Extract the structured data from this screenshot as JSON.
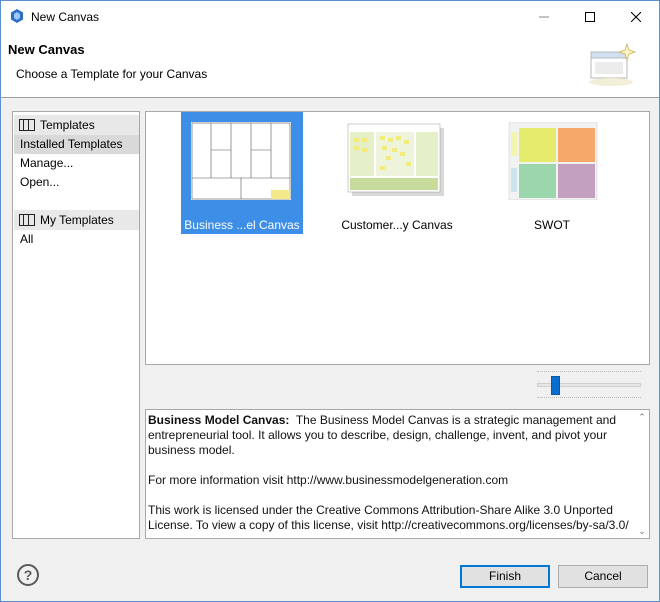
{
  "window": {
    "title": "New Canvas"
  },
  "header": {
    "title": "New Canvas",
    "subtitle": "Choose a Template for your Canvas"
  },
  "sidebar": {
    "groups": [
      {
        "label": "Templates",
        "icon": "table-icon",
        "items": [
          "Installed Templates",
          "Manage...",
          "Open..."
        ],
        "selected": "Installed Templates"
      },
      {
        "label": "My Templates",
        "icon": "table-icon",
        "items": [
          "All"
        ]
      }
    ]
  },
  "templates": [
    {
      "label": "Business ...el Canvas",
      "selected": true
    },
    {
      "label": "Customer...y Canvas",
      "selected": false
    },
    {
      "label": "SWOT",
      "selected": false
    }
  ],
  "zoom_slider": {
    "value": 0.15
  },
  "description": {
    "name": "Business Model Canvas:",
    "text": "The Business Model Canvas is a strategic management and entrepreneurial tool. It allows you to describe, design, challenge, invent, and pivot your business model.",
    "more_info": "For more information visit http://www.businessmodelgeneration.com",
    "license": "This work is licensed under the Creative Commons Attribution-Share Alike 3.0 Unported License. To view a copy of this license, visit http://creativecommons.org/licenses/by-sa/3.0/"
  },
  "buttons": {
    "finish": "Finish",
    "cancel": "Cancel"
  },
  "colors": {
    "selection": "#3d8ee6",
    "slider": "#0a6ed1",
    "default_button_border": "#0078d7"
  }
}
